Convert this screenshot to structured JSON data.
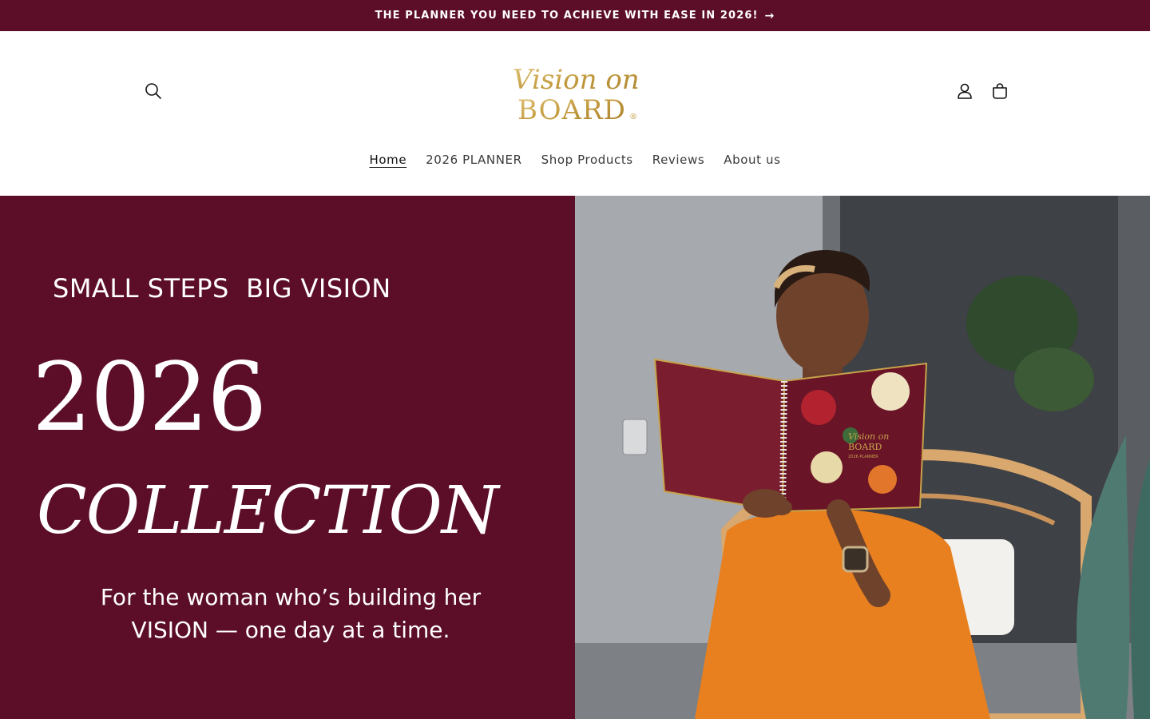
{
  "announcement": {
    "text": "THE PLANNER YOU NEED TO ACHIEVE WITH EASE IN 2026!",
    "arrow": "→"
  },
  "header": {
    "logo": {
      "script_text": "Vision on",
      "main_text": "BOARD",
      "mark": "®",
      "color": "#c7a24a"
    },
    "icons": {
      "search": "search-icon",
      "account": "account-icon",
      "cart": "cart-icon"
    }
  },
  "nav": {
    "items": [
      {
        "label": "Home",
        "active": true
      },
      {
        "label": "2026 PLANNER"
      },
      {
        "label": "Shop Products"
      },
      {
        "label": "Reviews"
      },
      {
        "label": "About us"
      }
    ]
  },
  "hero": {
    "tagline": "SMALL STEPS  BIG VISION",
    "year": "2026",
    "collection": "COLLECTION",
    "subcopy_line1": "For the woman who’s building her",
    "subcopy_line2": "VISION — one day at a time.",
    "background": "#5c0e29",
    "planner_cover": {
      "script_text": "Vision on",
      "main_text": "BOARD",
      "sub_text": "2026 PLANNER"
    }
  },
  "colors": {
    "brand": "#5c0e29",
    "gold": "#c7a24a",
    "text": "#121212"
  }
}
